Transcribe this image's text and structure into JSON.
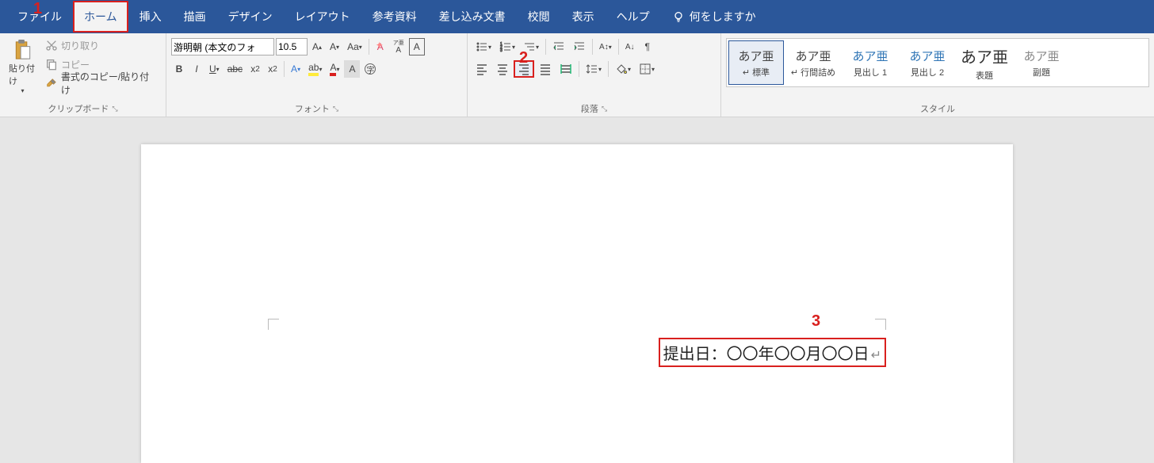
{
  "tabs": {
    "file": "ファイル",
    "home": "ホーム",
    "insert": "挿入",
    "draw": "描画",
    "design": "デザイン",
    "layout": "レイアウト",
    "references": "参考資料",
    "mailings": "差し込み文書",
    "review": "校閲",
    "view": "表示",
    "help": "ヘルプ",
    "tell_me": "何をしますか"
  },
  "clipboard": {
    "paste": "貼り付け",
    "cut": "切り取り",
    "copy": "コピー",
    "format_painter": "書式のコピー/貼り付け",
    "group": "クリップボード"
  },
  "font": {
    "family": "游明朝 (本文のフォ",
    "size": "10.5",
    "ruby": "ア亜",
    "group": "フォント"
  },
  "paragraph": {
    "group": "段落"
  },
  "styles": {
    "group": "スタイル",
    "sample": "あア亜",
    "sample_big": "あア亜",
    "items": [
      {
        "name": "標準"
      },
      {
        "name": "行間詰め"
      },
      {
        "name": "見出し 1"
      },
      {
        "name": "見出し 2"
      },
      {
        "name": "表題"
      },
      {
        "name": "副題"
      }
    ]
  },
  "document": {
    "text": "提出日：〇〇年〇〇月〇〇日"
  },
  "annotations": {
    "a1": "1",
    "a2": "2",
    "a3": "3"
  }
}
